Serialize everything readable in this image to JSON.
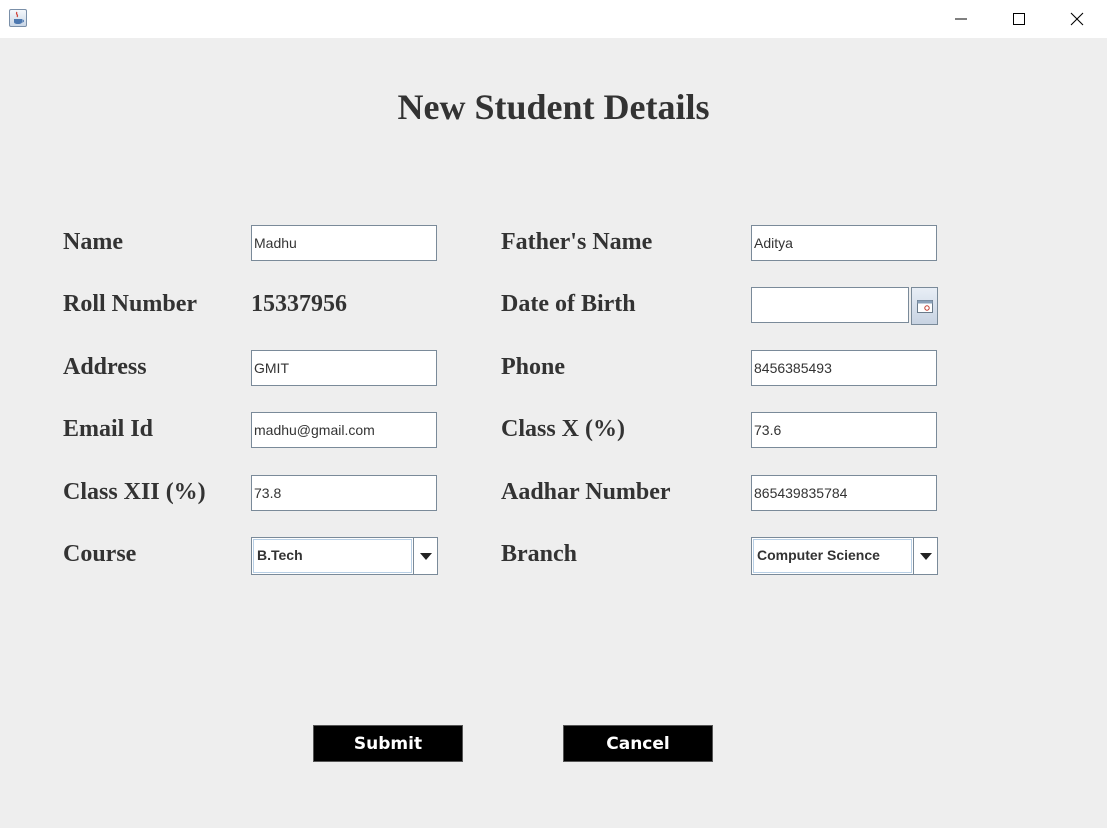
{
  "page_title": "New Student Details",
  "fields": {
    "name": {
      "label": "Name",
      "value": "Madhu"
    },
    "fathers_name": {
      "label": "Father's Name",
      "value": "Aditya"
    },
    "roll_number": {
      "label": "Roll Number",
      "value": "15337956"
    },
    "date_of_birth": {
      "label": "Date of Birth",
      "value": ""
    },
    "address": {
      "label": "Address",
      "value": "GMIT"
    },
    "phone": {
      "label": "Phone",
      "value": "8456385493"
    },
    "email": {
      "label": "Email Id",
      "value": "madhu@gmail.com"
    },
    "class_x": {
      "label": "Class X (%)",
      "value": "73.6"
    },
    "class_xii": {
      "label": "Class XII (%)",
      "value": "73.8"
    },
    "aadhar": {
      "label": "Aadhar Number",
      "value": "865439835784"
    },
    "course": {
      "label": "Course",
      "selected": "B.Tech"
    },
    "branch": {
      "label": "Branch",
      "selected": "Computer Science"
    }
  },
  "buttons": {
    "submit": "Submit",
    "cancel": "Cancel"
  },
  "icons": {
    "app": "java-cup-icon",
    "minimize": "minimize-icon",
    "maximize": "maximize-icon",
    "close": "close-icon",
    "calendar": "calendar-icon",
    "dropdown": "chevron-down-icon"
  },
  "colors": {
    "background": "#eeeeee",
    "text": "#333333",
    "button_bg": "#000000",
    "button_text": "#ffffff"
  }
}
